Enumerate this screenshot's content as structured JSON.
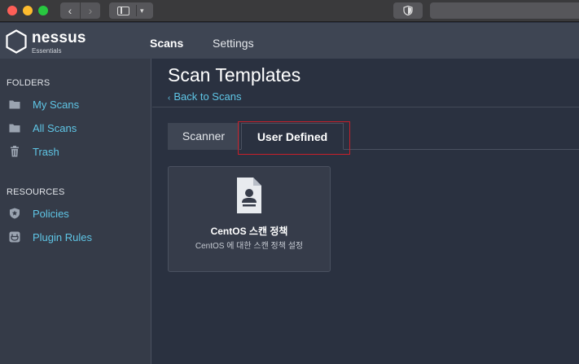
{
  "browser": {
    "back_glyph": "‹",
    "forward_glyph": "›",
    "dropdown_glyph": "▾"
  },
  "app": {
    "logo_name": "nessus",
    "logo_subtitle": "Essentials"
  },
  "topnav": {
    "scans": "Scans",
    "settings": "Settings"
  },
  "sidebar": {
    "folders_heading": "FOLDERS",
    "folders": [
      {
        "label": "My Scans",
        "icon": "folder-icon"
      },
      {
        "label": "All Scans",
        "icon": "folder-icon"
      },
      {
        "label": "Trash",
        "icon": "trash-icon"
      }
    ],
    "resources_heading": "RESOURCES",
    "resources": [
      {
        "label": "Policies",
        "icon": "policy-shield-icon"
      },
      {
        "label": "Plugin Rules",
        "icon": "plugin-rules-icon"
      }
    ]
  },
  "main": {
    "title": "Scan Templates",
    "back_link": "Back to Scans",
    "tabs": [
      {
        "label": "Scanner",
        "active": false
      },
      {
        "label": "User Defined",
        "active": true
      }
    ],
    "templates": [
      {
        "title": "CentOS 스캔 정책",
        "description": "CentOS 에 대한 스캔 정책 설정",
        "icon": "user-document-icon"
      }
    ]
  },
  "colors": {
    "accent_link": "#5fc6e6",
    "highlight_box": "#c8202a",
    "background": "#2a3140"
  }
}
